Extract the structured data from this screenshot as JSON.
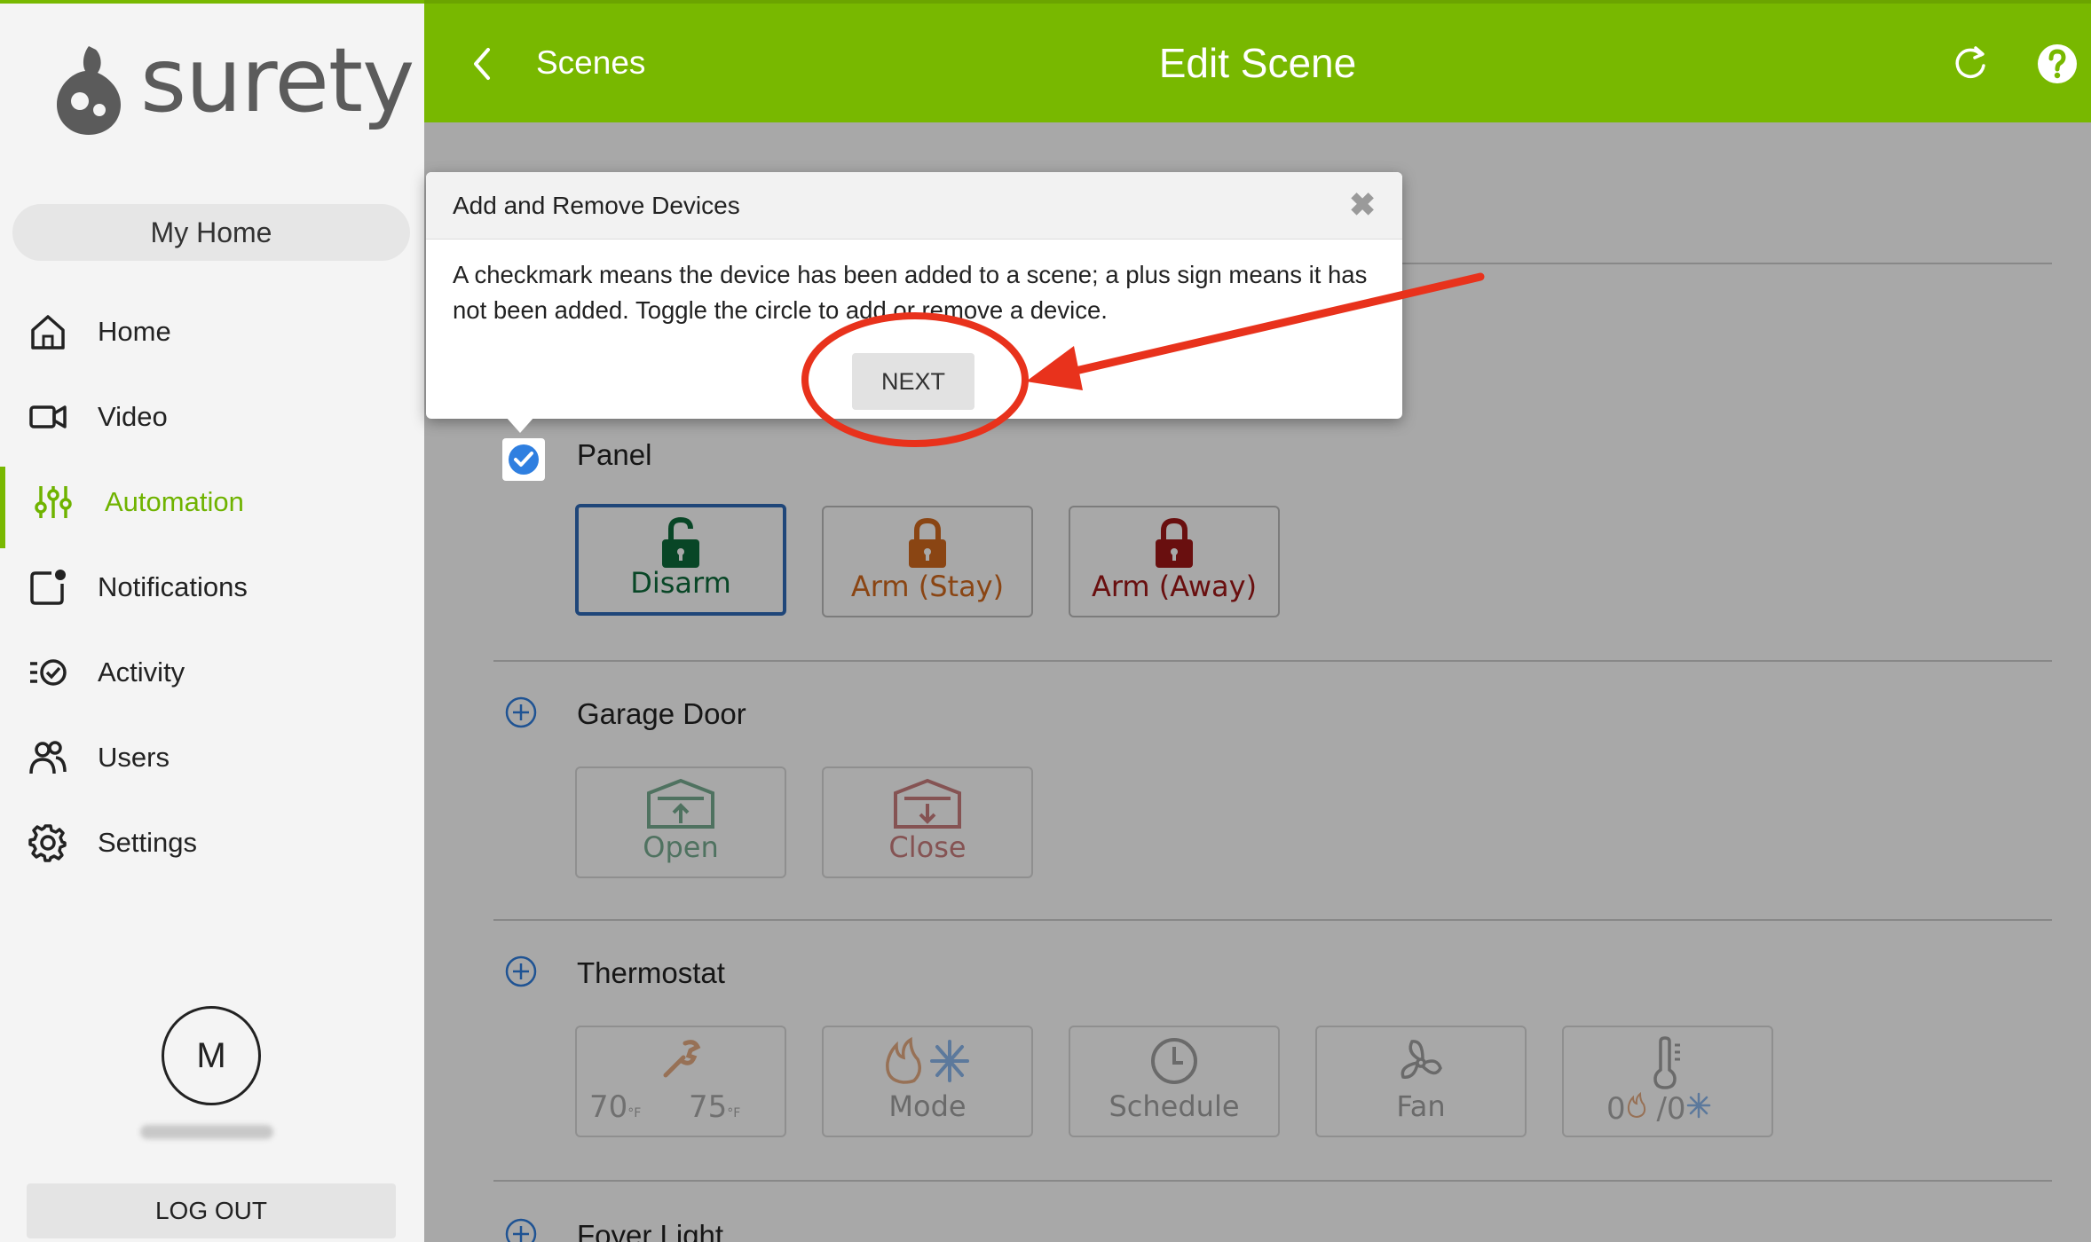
{
  "app": {
    "brand": "surety"
  },
  "sidebar": {
    "home_selector": "My Home",
    "items": [
      {
        "label": "Home",
        "icon": "house-icon"
      },
      {
        "label": "Video",
        "icon": "camera-icon"
      },
      {
        "label": "Automation",
        "icon": "sliders-icon",
        "active": true
      },
      {
        "label": "Notifications",
        "icon": "bell-icon"
      },
      {
        "label": "Activity",
        "icon": "activity-icon"
      },
      {
        "label": "Users",
        "icon": "users-icon"
      },
      {
        "label": "Settings",
        "icon": "gear-icon"
      }
    ],
    "avatar_initial": "M",
    "logout_label": "LOG OUT"
  },
  "header": {
    "back_label": "Scenes",
    "title": "Edit Scene"
  },
  "sections": {
    "panel": {
      "title": "Panel",
      "added": true,
      "tiles": [
        {
          "label": "Disarm",
          "color": "#0d6b3a",
          "selected": true
        },
        {
          "label": "Arm (Stay)",
          "color": "#d2691e"
        },
        {
          "label": "Arm (Away)",
          "color": "#a01818"
        }
      ]
    },
    "garage": {
      "title": "Garage Door",
      "added": false,
      "tiles": [
        {
          "label": "Open",
          "color": "#0d6b3a"
        },
        {
          "label": "Close",
          "color": "#a01818"
        }
      ]
    },
    "thermostat": {
      "title": "Thermostat",
      "added": false,
      "setpoint_low": "70",
      "setpoint_high": "75",
      "unit": "°F",
      "mode_label": "Mode",
      "schedule_label": "Schedule",
      "fan_label": "Fan",
      "temp_reading_a": "0",
      "temp_reading_b": "/0"
    },
    "next_section_title": "Foyer Light"
  },
  "popup": {
    "title": "Add and Remove Devices",
    "body": "A checkmark means the device has been added to a scene; a plus sign means it has not been added. Toggle the circle to add or remove a device.",
    "next_label": "NEXT"
  },
  "colors": {
    "accent": "#78b800",
    "check_blue": "#2f7fe0",
    "annotation_red": "#e8321c"
  }
}
